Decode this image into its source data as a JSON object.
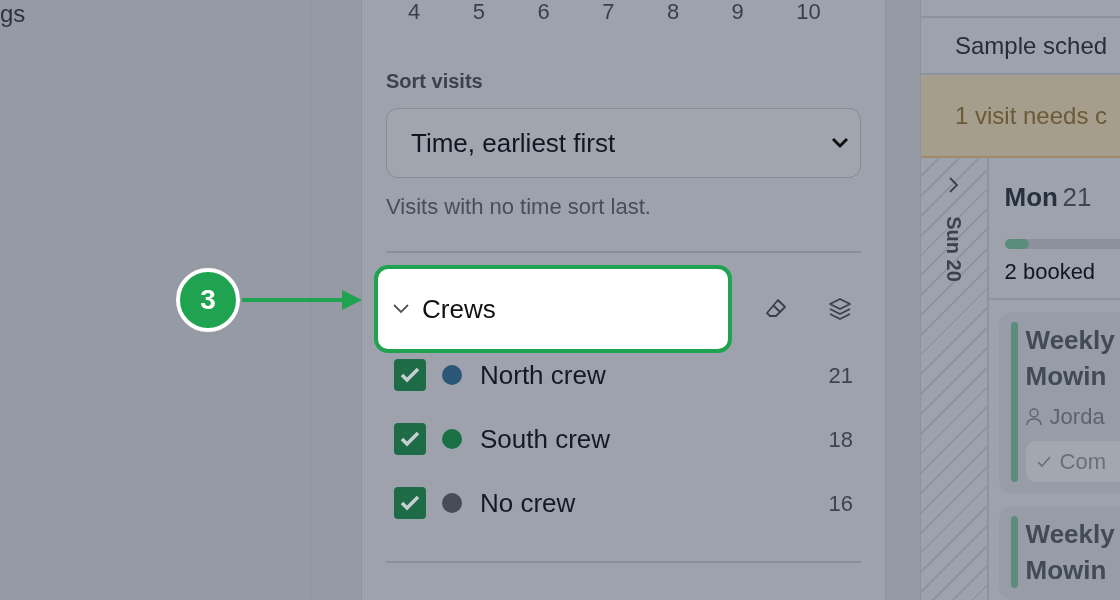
{
  "left_pane": {
    "text": "gs"
  },
  "filters": {
    "day_numbers": [
      "4",
      "5",
      "6",
      "7",
      "8",
      "9",
      "10"
    ],
    "sort": {
      "label": "Sort visits",
      "value": "Time, earliest first",
      "hint": "Visits with no time sort last."
    },
    "crews": {
      "title": "Crews",
      "expanded": true,
      "highlighted": true,
      "items": [
        {
          "name": "North crew",
          "checked": true,
          "color": "#2c5677",
          "count": "21"
        },
        {
          "name": "South crew",
          "checked": true,
          "color": "#1a7045",
          "count": "18"
        },
        {
          "name": "No crew",
          "checked": true,
          "color": "#474d58",
          "count": "16"
        }
      ]
    }
  },
  "schedule": {
    "title": "Sample sched",
    "alert": "1 visit needs c",
    "collapsed_day": {
      "label": "Sun 20",
      "expanded": false
    },
    "day": {
      "weekday": "Mon",
      "date": "21",
      "level": 0.12,
      "booked": "2 booked",
      "visits": [
        {
          "title": "Weekly Mowin",
          "assignee": "Jorda",
          "status": "Com"
        },
        {
          "title": "Weekly Mowin"
        }
      ]
    }
  },
  "callout": {
    "number": "3"
  }
}
